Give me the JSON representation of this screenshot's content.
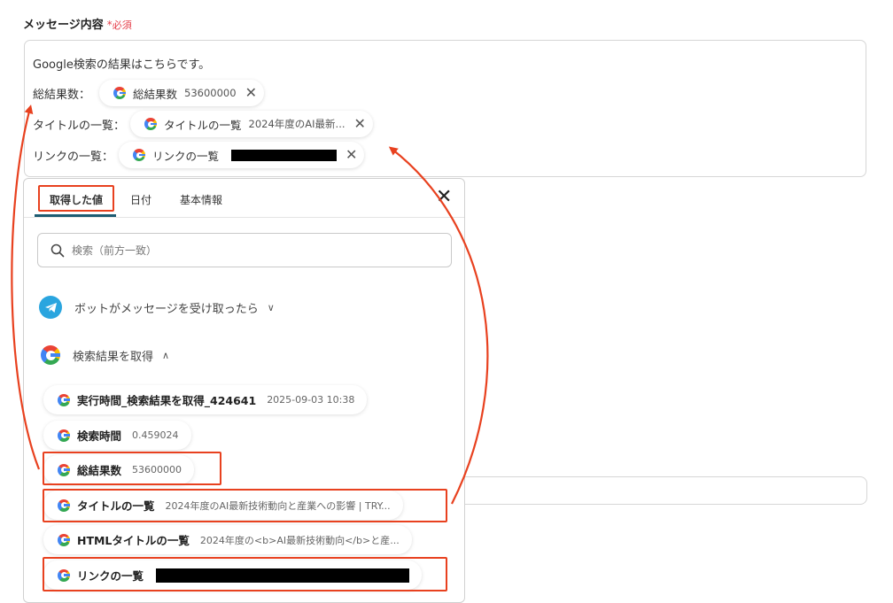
{
  "field": {
    "label": "メッセージ内容",
    "star": "*",
    "required": "必須"
  },
  "editor": {
    "intro": "Google検索の結果はこちらです。",
    "lines": [
      {
        "prefix": "総結果数：",
        "pill_name": "総結果数",
        "pill_value": "53600000"
      },
      {
        "prefix": "タイトルの一覧：",
        "pill_name": "タイトルの一覧",
        "pill_value": "2024年度のAI最新..."
      },
      {
        "prefix": "リンクの一覧：",
        "pill_name": "リンクの一覧",
        "pill_value": ""
      }
    ]
  },
  "panel": {
    "tabs": [
      "取得した値",
      "日付",
      "基本情報"
    ],
    "active_tab": "取得した値",
    "search_placeholder": "検索（前方一致）",
    "groups": [
      {
        "name": "ボットがメッセージを受け取ったら",
        "icon": "telegram-icon",
        "state": "collapsed"
      },
      {
        "name": "検索結果を取得",
        "icon": "google-icon",
        "state": "expanded"
      }
    ],
    "items": [
      {
        "name": "実行時間_検索結果を取得_424641",
        "value": "2025-09-03 10:38"
      },
      {
        "name": "検索時間",
        "value": "0.459024"
      },
      {
        "name": "総結果数",
        "value": "53600000"
      },
      {
        "name": "タイトルの一覧",
        "value": "2024年度のAI最新技術動向と産業への影響 | TRY..."
      },
      {
        "name": "HTMLタイトルの一覧",
        "value": "2024年度の<b>AI最新技術動向</b>と産..."
      },
      {
        "name": "リンクの一覧",
        "value": ""
      }
    ]
  },
  "colors": {
    "highlight": "#e8411f",
    "required": "#e5404b",
    "tab_active": "#1e5c72",
    "telegram": "#2aa5df"
  }
}
